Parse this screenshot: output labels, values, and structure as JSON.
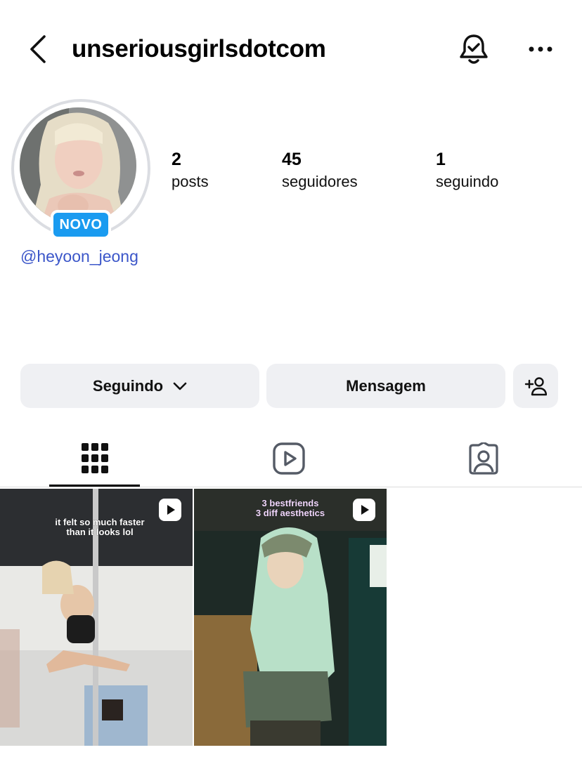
{
  "header": {
    "username": "unseriousgirlsdotcom",
    "back_icon": "chevron-left-icon",
    "bell_icon": "bell-check-icon",
    "more_icon": "more-horizontal-icon"
  },
  "profile": {
    "badge": "NOVO",
    "handle": "@heyoon_jeong",
    "badge_color": "#1a9bf0",
    "handle_color": "#3b56c9"
  },
  "stats": [
    {
      "value": "2",
      "label": "posts"
    },
    {
      "value": "45",
      "label": "seguidores"
    },
    {
      "value": "1",
      "label": "seguindo"
    }
  ],
  "actions": {
    "following_label": "Seguindo",
    "message_label": "Mensagem",
    "add_icon": "add-person-icon"
  },
  "tabs": [
    {
      "name": "grid",
      "icon": "grid-icon",
      "active": true
    },
    {
      "name": "reels",
      "icon": "reels-icon",
      "active": false
    },
    {
      "name": "tagged",
      "icon": "tagged-person-icon",
      "active": false
    }
  ],
  "posts": [
    {
      "caption_line1": "it felt so much faster",
      "caption_line2": "than it looks lol",
      "type": "reel"
    },
    {
      "caption_line1": "3 bestfriends",
      "caption_line2": "3 diff aesthetics",
      "type": "reel"
    }
  ]
}
